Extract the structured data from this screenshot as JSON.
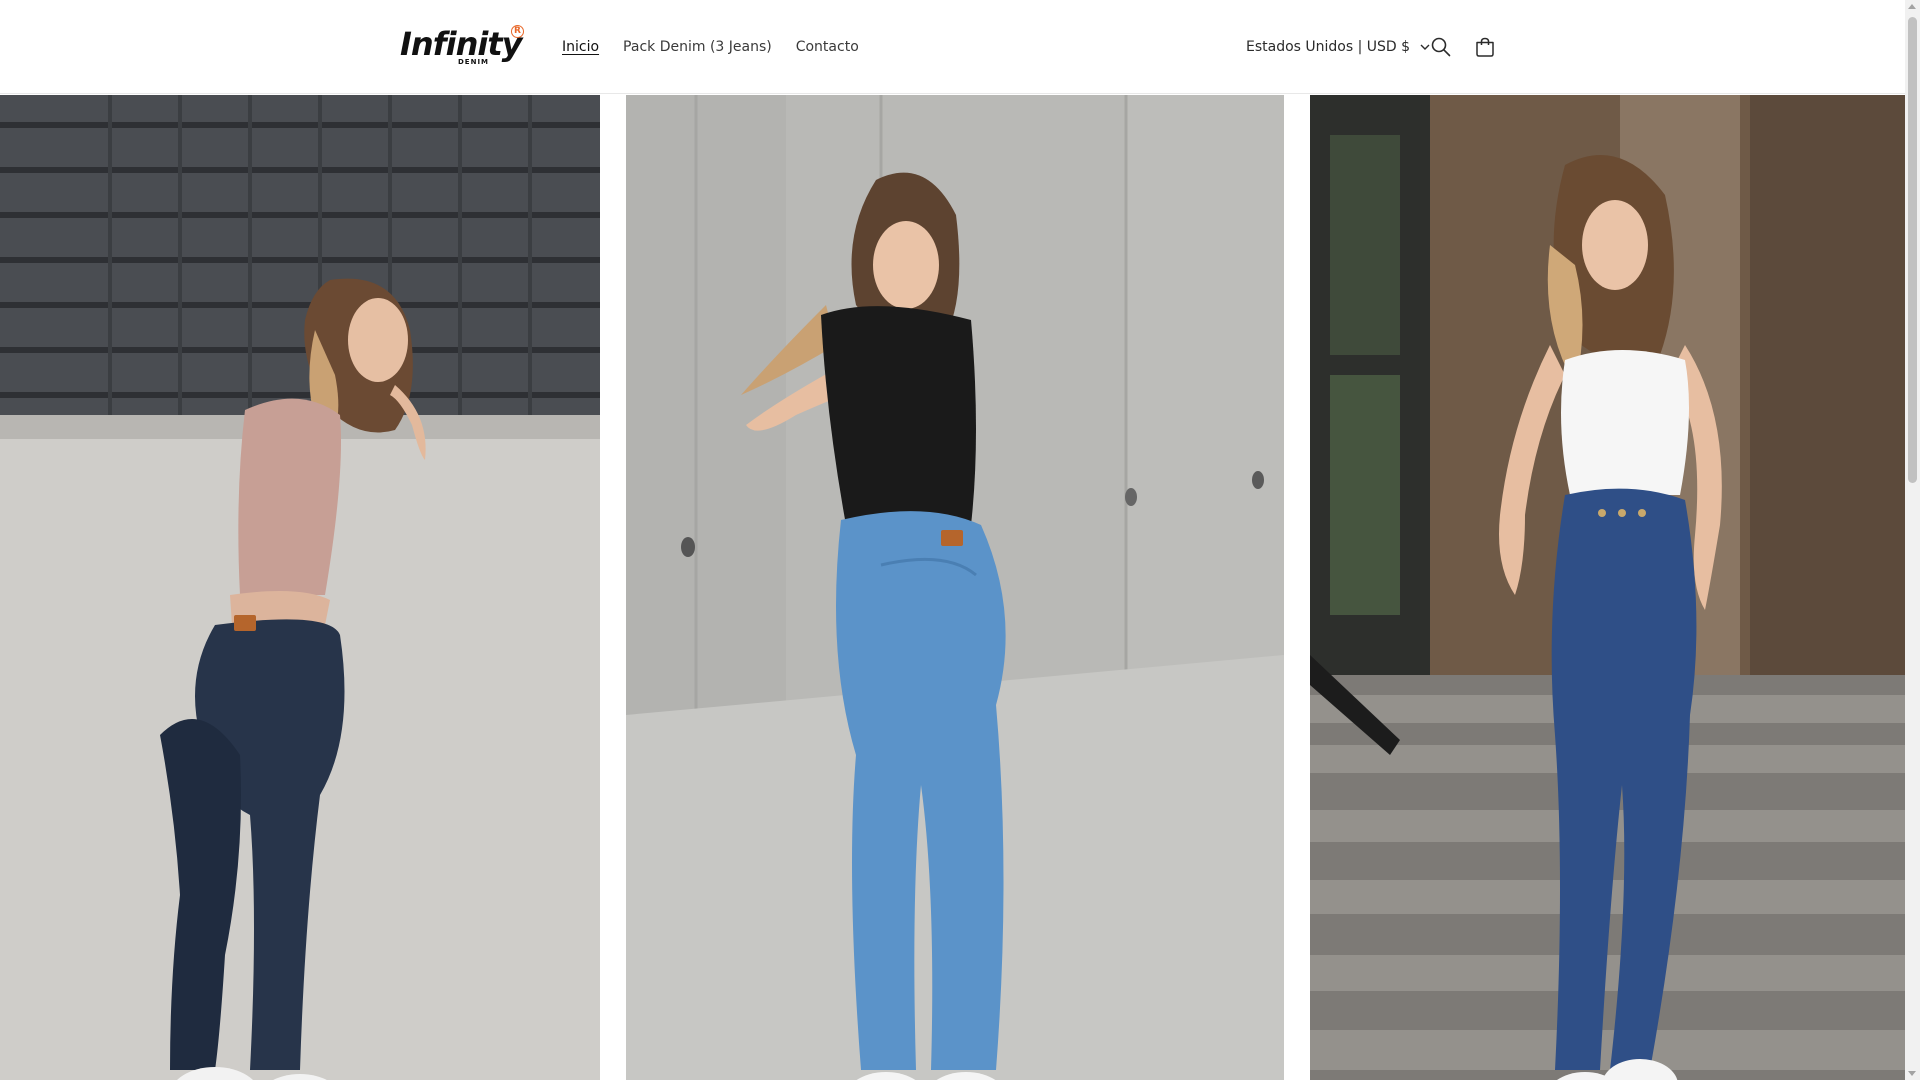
{
  "brand": {
    "logo_text": "Infinity",
    "logo_sub": "DENIM",
    "logo_mark": "R",
    "accent_color": "#e8682a"
  },
  "nav": {
    "items": [
      {
        "label": "Inicio",
        "active": true
      },
      {
        "label": "Pack Denim (3 Jeans)",
        "active": false
      },
      {
        "label": "Contacto",
        "active": false
      }
    ]
  },
  "header": {
    "locale_label": "Estados Unidos | USD $",
    "icons": {
      "locale": "chevron-down-icon",
      "search": "search-icon",
      "cart": "cart-icon"
    }
  },
  "gallery": {
    "images": [
      {
        "subject": "model-pink-top-dark-jeans"
      },
      {
        "subject": "model-black-top-light-jeans"
      },
      {
        "subject": "model-white-top-mid-jeans"
      }
    ]
  }
}
